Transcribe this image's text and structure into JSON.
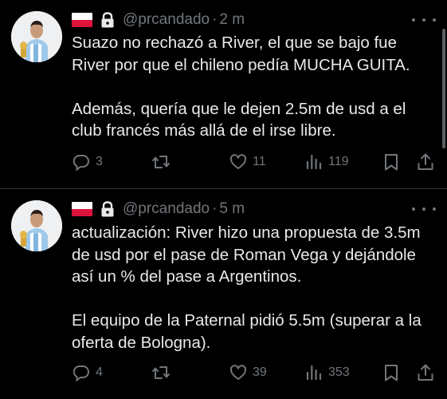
{
  "tweets": [
    {
      "handle": "@prcandado",
      "separator": "·",
      "time": "2 m",
      "lines": [
        "Suazo no rechazó a River, el que se bajo fue",
        "River por que el chileno pedía MUCHA GUITA.",
        "",
        "Además, quería que le dejen 2.5m de usd a el",
        "club francés más allá de el irse libre."
      ],
      "replies": "3",
      "retweets": "",
      "likes": "11",
      "views": "119"
    },
    {
      "handle": "@prcandado",
      "separator": "·",
      "time": "5 m",
      "lines": [
        "actualización: River hizo una propuesta de 3.5m",
        "de usd por el pase de Roman Vega y dejándole",
        "así un % del pase a Argentinos.",
        "",
        "El equipo de la Paternal pidió 5.5m (superar a la",
        "oferta de Bologna)."
      ],
      "replies": "4",
      "retweets": "",
      "likes": "39",
      "views": "353"
    }
  ],
  "icons": {
    "flag": "poland-flag-icon",
    "lock": "lock-icon",
    "more": "more-icon",
    "reply": "reply-icon",
    "retweet": "retweet-icon",
    "like": "heart-icon",
    "views": "views-icon",
    "bookmark": "bookmark-icon",
    "share": "share-icon"
  },
  "colors": {
    "background": "#000000",
    "text": "#e7e9ea",
    "secondary": "#71767b",
    "divider": "#2f3336"
  }
}
